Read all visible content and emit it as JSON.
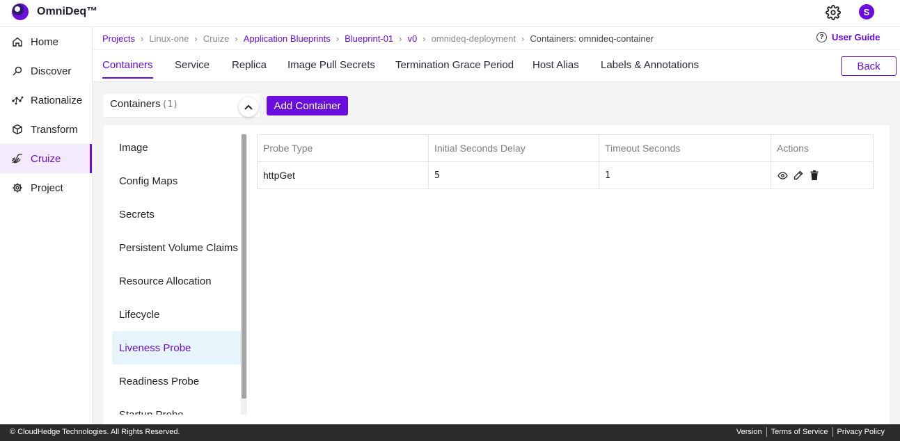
{
  "app": {
    "brand": "OmniDeq™",
    "avatar_initial": "S",
    "accent_color": "#6a0dde"
  },
  "sidebar": {
    "items": [
      {
        "label": "Home",
        "icon": "home-icon"
      },
      {
        "label": "Discover",
        "icon": "discover-icon"
      },
      {
        "label": "Rationalize",
        "icon": "rationalize-icon"
      },
      {
        "label": "Transform",
        "icon": "cube-icon"
      },
      {
        "label": "Cruize",
        "icon": "cruize-icon",
        "active": true
      },
      {
        "label": "Project",
        "icon": "gear-icon"
      }
    ]
  },
  "breadcrumb": {
    "items": [
      "Projects",
      "Linux-one",
      "Cruize",
      "Application Blueprints",
      "Blueprint-01",
      "v0",
      "omnideq-deployment",
      "Containers: omnideq-container"
    ],
    "separator": "›"
  },
  "user_guide": {
    "label": "User Guide",
    "icon": "help-circle-icon"
  },
  "tabs": [
    "Containers",
    "Service",
    "Replica",
    "Image Pull Secrets",
    "Termination Grace Period",
    "Host Alias",
    "Labels & Annotations"
  ],
  "back_label": "Back",
  "containers_header": {
    "label": "Containers",
    "count": "(1)"
  },
  "add_container_label": "Add Container",
  "container_menu": [
    "Image",
    "Config Maps",
    "Secrets",
    "Persistent Volume Claims",
    "Resource Allocation",
    "Lifecycle",
    "Liveness Probe",
    "Readiness Probe",
    "Startup Probe"
  ],
  "container_menu_active": "Liveness Probe",
  "probe_table": {
    "headers": [
      "Probe Type",
      "Initial Seconds Delay",
      "Timeout Seconds",
      "Actions"
    ],
    "rows": [
      {
        "probe_type": "httpGet",
        "initial_delay": "5",
        "timeout": "1",
        "actions": [
          "view-icon",
          "edit-icon",
          "delete-icon"
        ]
      }
    ]
  },
  "footer": {
    "copyright": "© CloudHedge Technologies. All Rights Reserved.",
    "links": [
      "Version",
      "Terms of Service",
      "Privacy Policy"
    ]
  }
}
